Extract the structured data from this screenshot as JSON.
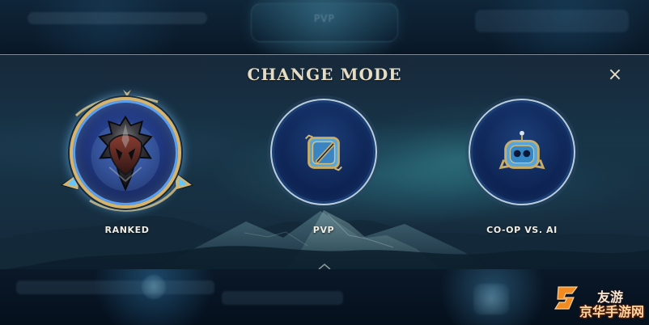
{
  "modal": {
    "title": "CHANGE MODE",
    "close_label": "×"
  },
  "modes": [
    {
      "label": "RANKED",
      "icon": "ranked-iron-emblem-icon",
      "state": "selected"
    },
    {
      "label": "PVP",
      "icon": "pvp-sword-icon",
      "state": "available"
    },
    {
      "label": "CO-OP VS. AI",
      "icon": "co-op-robot-icon",
      "state": "available"
    }
  ],
  "background": {
    "top_pill_label": "PVP"
  },
  "watermark": {
    "primary": "京华手游网",
    "secondary": "友游"
  },
  "colors": {
    "accent_gold": "#d7b46b",
    "selected_glow": "#5da8ff",
    "text_primary": "#f1eee5",
    "title_text": "#e6dcc3"
  }
}
